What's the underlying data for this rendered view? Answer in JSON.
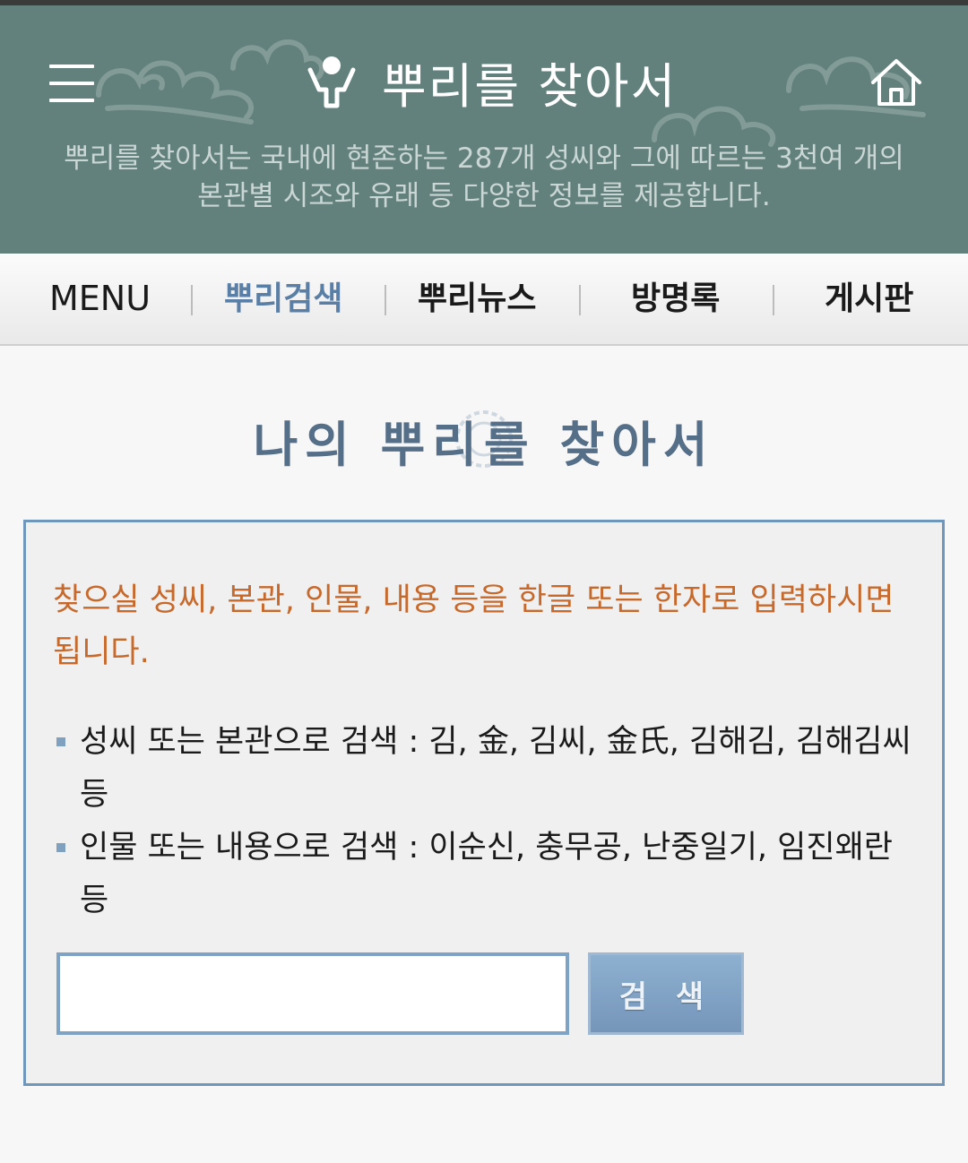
{
  "header": {
    "title": "뿌리를 찾아서",
    "description_line1": "뿌리를 찾아서는 국내에 현존하는 287개 성씨와 그에 따르는 3천여 개의",
    "description_line2": "본관별 시조와 유래 등 다양한 정보를 제공합니다."
  },
  "nav": {
    "items": [
      {
        "label": "MENU"
      },
      {
        "label": "뿌리검색"
      },
      {
        "label": "뿌리뉴스"
      },
      {
        "label": "방명록"
      },
      {
        "label": "게시판"
      }
    ],
    "active_color": "#5a7fa6"
  },
  "main": {
    "section_title": "나의 뿌리를 찾아서",
    "guide": "찾으실 성씨, 본관, 인물, 내용 등을 한글 또는 한자로 입력하시면 됩니다.",
    "examples": [
      {
        "text": "성씨 또는 본관으로 검색 : 김, 金, 김씨, 金氏, 김해김, 김해김씨 등"
      },
      {
        "text": "인물 또는 내용으로 검색 : 이순신, 충무공, 난중일기, 임진왜란 등"
      }
    ],
    "search": {
      "input_value": "",
      "button_label": "검 색"
    }
  },
  "colors": {
    "header_bg": "#62807c",
    "guide_text": "#c8692c",
    "box_border": "#6e97bb"
  },
  "icons": [
    "menu-icon",
    "logo-icon",
    "home-icon"
  ]
}
